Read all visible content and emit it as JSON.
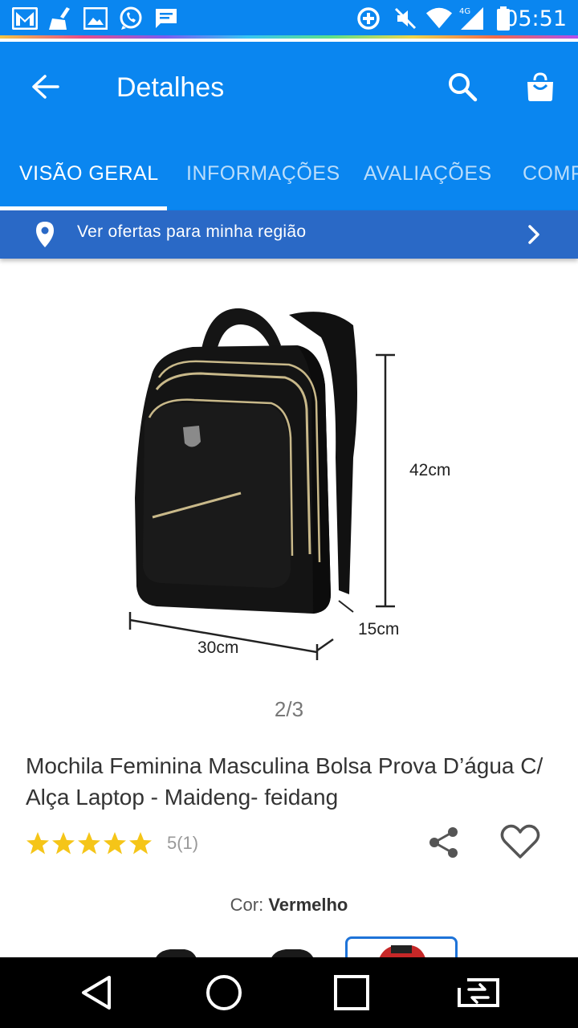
{
  "status_bar": {
    "time": "05:51",
    "network": "4G",
    "icons": [
      "gmail-icon",
      "cleaner-icon",
      "gallery-icon",
      "whatsapp-icon",
      "message-icon",
      "data-saver-icon",
      "mute-icon",
      "wifi-icon",
      "signal-icon",
      "battery-icon"
    ]
  },
  "app_bar": {
    "title": "Detalhes",
    "back_icon": "arrow-left-icon",
    "search_icon": "search-icon",
    "cart_icon": "shopping-bag-icon"
  },
  "tabs": [
    {
      "label": "VISÃO GERAL",
      "active": true
    },
    {
      "label": "INFORMAÇÕES",
      "active": false
    },
    {
      "label": "AVALIAÇÕES",
      "active": false
    },
    {
      "label": "COMP",
      "active": false
    }
  ],
  "region_banner": {
    "label": "Ver ofertas para minha região"
  },
  "product": {
    "image_dimensions": {
      "height": "42cm",
      "depth": "15cm",
      "width": "30cm"
    },
    "pager": "2/3",
    "title": "Mochila Feminina Masculina Bolsa Prova D’água C/ Alça Laptop - Maideng- feidang",
    "rating": {
      "stars": 5,
      "count_text": "5(1)"
    },
    "color_label": "Cor:",
    "color_value": "Vermelho"
  },
  "colors": {
    "primary": "#0a86f0",
    "banner": "#2a69c6",
    "star": "#f5c518",
    "selected_border": "#1e73d8"
  }
}
